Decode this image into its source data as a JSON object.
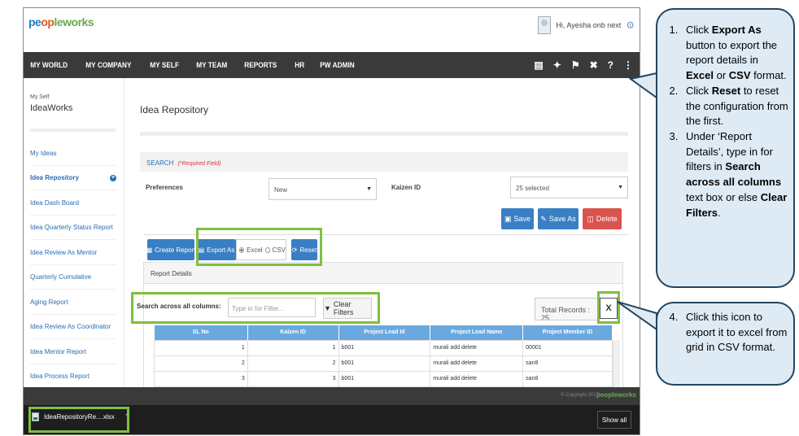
{
  "app": {
    "logo": {
      "part1": "pe",
      "part2": "op",
      "part3": "leworks"
    },
    "greeting": "Hi, Ayesha onb next",
    "nav_items": [
      "MY WORLD",
      "MY COMPANY",
      "MY SELF",
      "MY TEAM",
      "REPORTS",
      "HR",
      "PW ADMIN"
    ],
    "nav_icons": [
      "book-icon",
      "bulb-icon",
      "flag-icon",
      "tools-icon",
      "help-icon",
      "share-icon"
    ]
  },
  "sidebar": {
    "section": "My Self",
    "title": "IdeaWorks",
    "items": [
      {
        "label": "My Ideas"
      },
      {
        "label": "Idea Repository"
      },
      {
        "label": "Idea Dash Board"
      },
      {
        "label": "Idea Quarterly Status Report"
      },
      {
        "label": "Idea Review As Mentor"
      },
      {
        "label": "Quarterly Cumulative"
      },
      {
        "label": "Aging Report"
      },
      {
        "label": "Idea Review As Coordinator"
      },
      {
        "label": "Idea Mentor Report"
      },
      {
        "label": "Idea Process Report"
      }
    ]
  },
  "main": {
    "title": "Idea Repository",
    "search_label": "SEARCH",
    "required_note": "(*Required Field)",
    "preferences_label": "Preferences",
    "preferences_value": "New",
    "kaizen_label": "Kaizen ID",
    "kaizen_value": "25 selected",
    "save_label": "Save",
    "save_as_label": "Save As",
    "delete_label": "Delete",
    "create_report_label": "Create Report",
    "export_as_label": "Export As",
    "excel_label": "Excel",
    "csv_label": "CSV",
    "reset_label": "Reset",
    "report_details_label": "Report Details",
    "search_across_label": "Search across all columns:",
    "search_placeholder": "Type in for Filter...",
    "clear_filters_label": "Clear Filters",
    "total_records_label": "Total Records : 25",
    "grid": {
      "columns": [
        "SL No",
        "Kaizen ID",
        "Project Lead Id",
        "Project Lead Name",
        "Project Member ID"
      ],
      "rows": [
        [
          "1",
          "1",
          "b001",
          "murali add delete",
          "00001"
        ],
        [
          "2",
          "2",
          "b001",
          "murali add delete",
          "san8"
        ],
        [
          "3",
          "3",
          "b001",
          "murali add delete",
          "san8"
        ]
      ]
    }
  },
  "footer": {
    "copyright": "© Copyright 2017",
    "logo_text": "peopleworks"
  },
  "downloads": {
    "file_name": "IdeaRepositoryRe....xlsx",
    "show_all": "Show all"
  },
  "callouts": {
    "step1": {
      "a": "Click ",
      "b": "Export As",
      "c": " button to export the report details in ",
      "d": "Excel",
      "e": " or ",
      "f": "CSV",
      "g": " format."
    },
    "step2": {
      "a": "Click ",
      "b": "Reset",
      "c": " to reset the configuration from the first."
    },
    "step3": {
      "a": "Under ‘Report Details’, type in for filters in ",
      "b": "Search across all columns",
      "c": " text box or else ",
      "d": "Clear Filters",
      "e": "."
    },
    "step4": {
      "a": "Click this icon to export it to excel from grid in CSV format."
    }
  },
  "colors": {
    "nav_bg": "#3a3a3a",
    "accent_blue": "#3a7fc4",
    "delete_red": "#d9534f",
    "highlight_green": "#7fbf3f",
    "callout_fill": "#deebf5",
    "callout_border": "#24455f"
  }
}
